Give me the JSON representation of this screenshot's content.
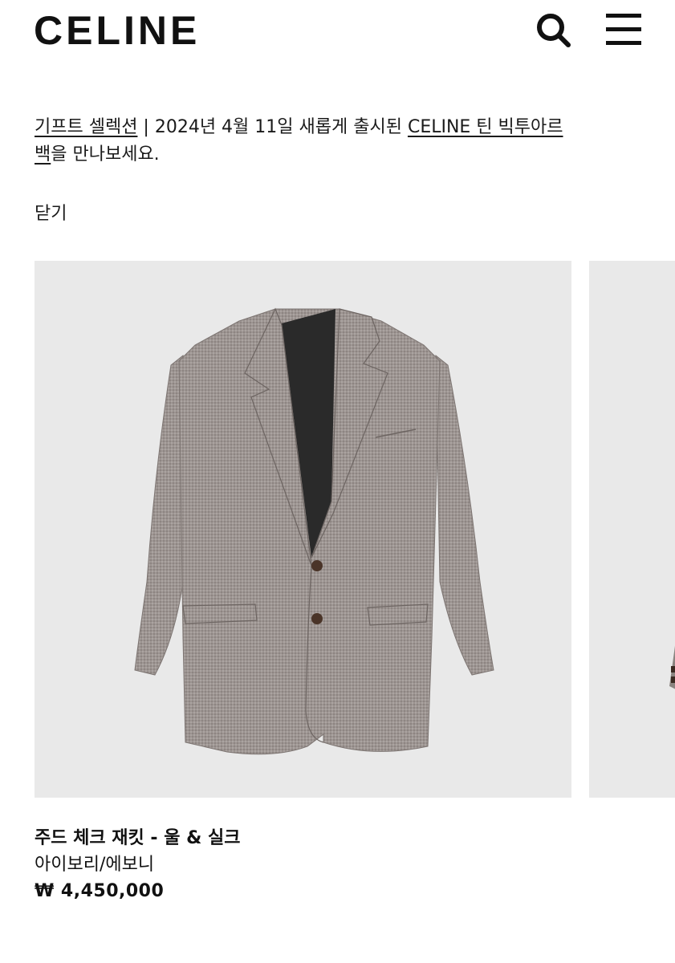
{
  "header": {
    "logo": "CELINE",
    "search_icon": "search-icon",
    "menu_icon": "hamburger-menu-icon"
  },
  "announcement": {
    "link1": "기프트 셀렉션",
    "separator": " | 2024년 4월 11일 새롭게 출시된 ",
    "link2_part1": "CELINE 틴 빅투아르",
    "link2_part2": "백",
    "tail": "을 만나보세요."
  },
  "close_label": "닫기",
  "product": {
    "name": "주드 체크 재킷 - 울 & 실크",
    "color": "아이보리/에보니",
    "price": "₩ 4,450,000"
  },
  "colors": {
    "background": "#ffffff",
    "image_bg": "#e9e9e9",
    "jacket": "#9b928f",
    "lining": "#2a2a2a",
    "button": "#4a3428"
  }
}
